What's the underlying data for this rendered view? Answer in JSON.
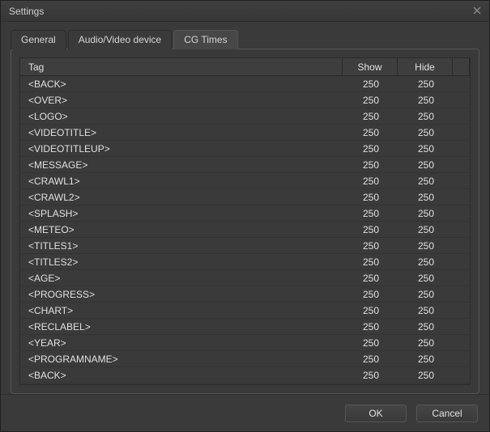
{
  "window": {
    "title": "Settings"
  },
  "tabs": [
    {
      "id": "general",
      "label": "General",
      "active": false
    },
    {
      "id": "avdevice",
      "label": "Audio/Video device",
      "active": false
    },
    {
      "id": "cgtimes",
      "label": "CG Times",
      "active": true
    }
  ],
  "grid": {
    "headers": {
      "tag": "Tag",
      "show": "Show",
      "hide": "Hide"
    },
    "rows": [
      {
        "tag": "<BACK>",
        "show": 250,
        "hide": 250
      },
      {
        "tag": "<OVER>",
        "show": 250,
        "hide": 250
      },
      {
        "tag": "<LOGO>",
        "show": 250,
        "hide": 250
      },
      {
        "tag": "<VIDEOTITLE>",
        "show": 250,
        "hide": 250
      },
      {
        "tag": "<VIDEOTITLEUP>",
        "show": 250,
        "hide": 250
      },
      {
        "tag": "<MESSAGE>",
        "show": 250,
        "hide": 250
      },
      {
        "tag": "<CRAWL1>",
        "show": 250,
        "hide": 250
      },
      {
        "tag": "<CRAWL2>",
        "show": 250,
        "hide": 250
      },
      {
        "tag": "<SPLASH>",
        "show": 250,
        "hide": 250
      },
      {
        "tag": "<METEO>",
        "show": 250,
        "hide": 250
      },
      {
        "tag": "<TITLES1>",
        "show": 250,
        "hide": 250
      },
      {
        "tag": "<TITLES2>",
        "show": 250,
        "hide": 250
      },
      {
        "tag": "<AGE>",
        "show": 250,
        "hide": 250
      },
      {
        "tag": "<PROGRESS>",
        "show": 250,
        "hide": 250
      },
      {
        "tag": "<CHART>",
        "show": 250,
        "hide": 250
      },
      {
        "tag": "<RECLABEL>",
        "show": 250,
        "hide": 250
      },
      {
        "tag": "<YEAR>",
        "show": 250,
        "hide": 250
      },
      {
        "tag": "<PROGRAMNAME>",
        "show": 250,
        "hide": 250
      },
      {
        "tag": "<BACK>",
        "show": 250,
        "hide": 250
      }
    ]
  },
  "buttons": {
    "ok": "OK",
    "cancel": "Cancel"
  }
}
